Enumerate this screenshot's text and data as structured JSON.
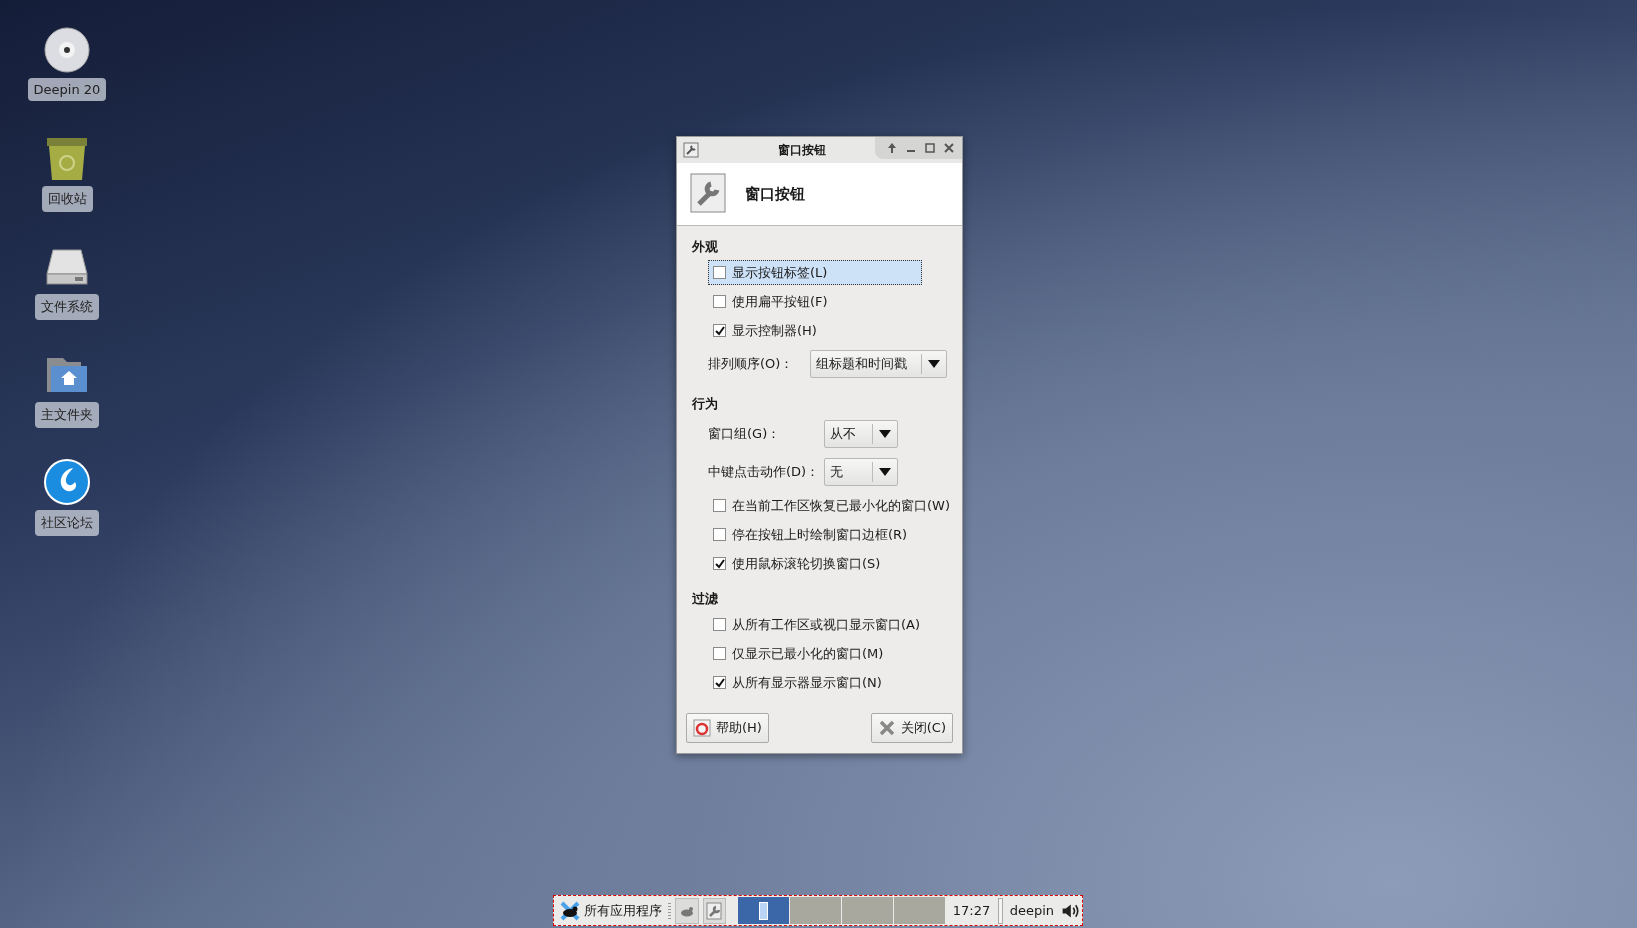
{
  "desktop_icons": [
    {
      "kind": "disc",
      "label": "Deepin 20"
    },
    {
      "kind": "trash",
      "label": "回收站"
    },
    {
      "kind": "drive",
      "label": "文件系统"
    },
    {
      "kind": "home",
      "label": "主文件夹"
    },
    {
      "kind": "logo",
      "label": "社区论坛"
    }
  ],
  "dialog": {
    "title": "窗口按钮",
    "header": "窗口按钮",
    "sections": [
      {
        "heading": "外观",
        "items": [
          {
            "kind": "checkbox",
            "label": "显示按钮标签(L)",
            "checked": false,
            "focused": true
          },
          {
            "kind": "checkbox",
            "label": "使用扁平按钮(F)",
            "checked": false,
            "focused": false
          },
          {
            "kind": "checkbox",
            "label": "显示控制器(H)",
            "checked": true,
            "focused": false
          },
          {
            "kind": "dropdown",
            "label": "排列顺序(O)：",
            "value": "组标题和时间戳"
          }
        ]
      },
      {
        "heading": "行为",
        "items": [
          {
            "kind": "dropdown",
            "label": "窗口组(G)：",
            "value": "从不"
          },
          {
            "kind": "dropdown",
            "label": "中键点击动作(D)：",
            "value": "无"
          },
          {
            "kind": "checkbox",
            "label": "在当前工作区恢复已最小化的窗口(W)",
            "checked": false,
            "focused": false
          },
          {
            "kind": "checkbox",
            "label": "停在按钮上时绘制窗口边框(R)",
            "checked": false,
            "focused": false
          },
          {
            "kind": "checkbox",
            "label": "使用鼠标滚轮切换窗口(S)",
            "checked": true,
            "focused": false
          }
        ]
      },
      {
        "heading": "过滤",
        "items": [
          {
            "kind": "checkbox",
            "label": "从所有工作区或视口显示窗口(A)",
            "checked": false,
            "focused": false
          },
          {
            "kind": "checkbox",
            "label": "仅显示已最小化的窗口(M)",
            "checked": false,
            "focused": false
          },
          {
            "kind": "checkbox",
            "label": "从所有显示器显示窗口(N)",
            "checked": true,
            "focused": false
          }
        ]
      }
    ],
    "buttons": [
      {
        "kind": "help",
        "label": "帮助(H)"
      },
      {
        "kind": "close",
        "label": "关闭(C)"
      }
    ]
  },
  "taskbar": {
    "app_menu": "所有应用程序",
    "workspaces": [
      {
        "selected": true
      },
      {
        "selected": false
      },
      {
        "selected": false
      },
      {
        "selected": false
      }
    ],
    "clock": "17:27",
    "user": "deepin"
  }
}
